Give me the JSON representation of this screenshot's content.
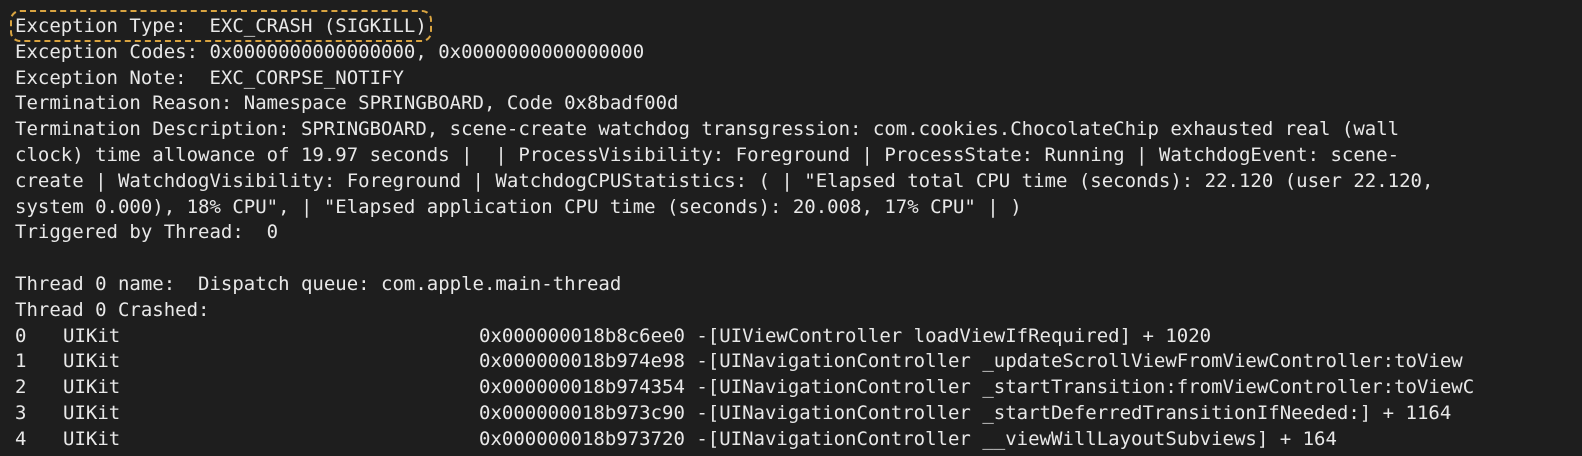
{
  "header_lines": {
    "exception_type": "Exception Type:  EXC_CRASH (SIGKILL)",
    "exception_codes": "Exception Codes: 0x0000000000000000, 0x0000000000000000",
    "exception_note": "Exception Note:  EXC_CORPSE_NOTIFY",
    "termination_reason": "Termination Reason: Namespace SPRINGBOARD, Code 0x8badf00d",
    "termination_desc_1": "Termination Description: SPRINGBOARD, scene-create watchdog transgression: com.cookies.ChocolateChip exhausted real (wall",
    "termination_desc_2": "clock) time allowance of 19.97 seconds |  | ProcessVisibility: Foreground | ProcessState: Running | WatchdogEvent: scene-",
    "termination_desc_3": "create | WatchdogVisibility: Foreground | WatchdogCPUStatistics: ( | \"Elapsed total CPU time (seconds): 22.120 (user 22.120,",
    "termination_desc_4": "system 0.000), 18% CPU\", | \"Elapsed application CPU time (seconds): 20.008, 17% CPU\" | )",
    "triggered_by": "Triggered by Thread:  0"
  },
  "thread": {
    "name_line": "Thread 0 name:  Dispatch queue: com.apple.main-thread",
    "crashed_line": "Thread 0 Crashed:",
    "frames": [
      {
        "index": "0",
        "library": "UIKit",
        "rest": "0x000000018b8c6ee0 -[UIViewController loadViewIfRequired] + 1020"
      },
      {
        "index": "1",
        "library": "UIKit",
        "rest": "0x000000018b974e98 -[UINavigationController _updateScrollViewFromViewController:toView"
      },
      {
        "index": "2",
        "library": "UIKit",
        "rest": "0x000000018b974354 -[UINavigationController _startTransition:fromViewController:toViewC"
      },
      {
        "index": "3",
        "library": "UIKit",
        "rest": "0x000000018b973c90 -[UINavigationController _startDeferredTransitionIfNeeded:] + 1164"
      },
      {
        "index": "4",
        "library": "UIKit",
        "rest": "0x000000018b973720 -[UINavigationController __viewWillLayoutSubviews] + 164"
      }
    ]
  },
  "colors": {
    "background": "#1e1e1e",
    "text": "#e8e8e8",
    "highlight_border": "#d9a441"
  }
}
